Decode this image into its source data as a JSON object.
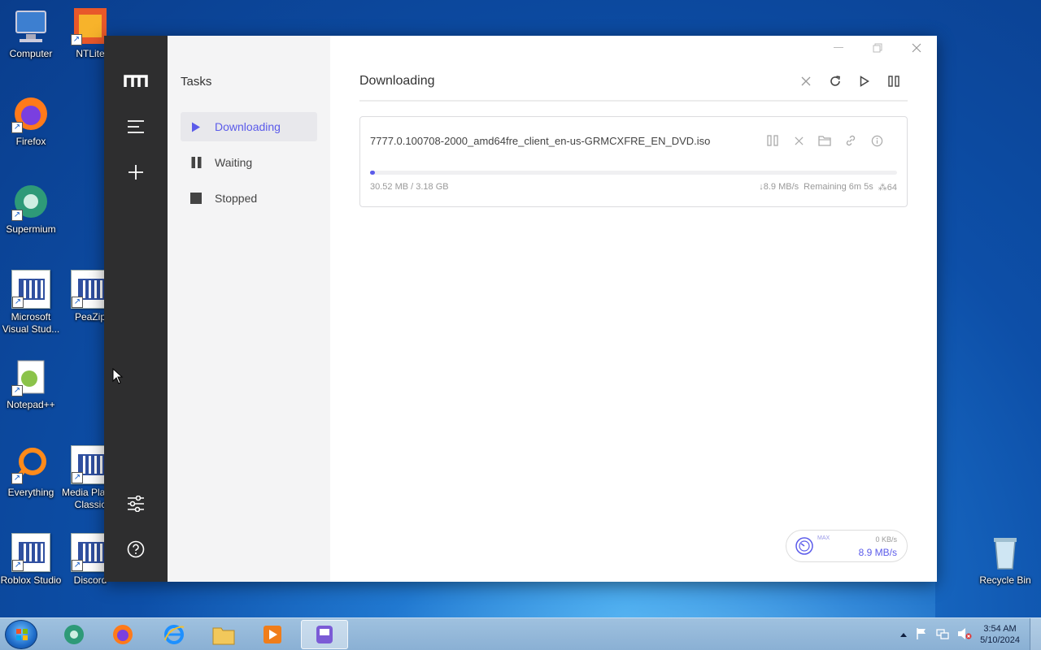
{
  "desktop": {
    "icons": [
      {
        "label": "Computer"
      },
      {
        "label": "NTLite"
      },
      {
        "label": "Firefox"
      },
      {
        "label": "Supermium"
      },
      {
        "label": "Microsoft Visual Stud..."
      },
      {
        "label": "PeaZip"
      },
      {
        "label": "Notepad++"
      },
      {
        "label": "Everything"
      },
      {
        "label": "Media Player Classic"
      },
      {
        "label": "Roblox Studio"
      },
      {
        "label": "Discord"
      },
      {
        "label": "Recycle Bin"
      }
    ]
  },
  "sidebar": {
    "title": "Tasks",
    "items": [
      {
        "label": "Downloading",
        "icon": "play-icon",
        "active": true
      },
      {
        "label": "Waiting",
        "icon": "pause-icon",
        "active": false
      },
      {
        "label": "Stopped",
        "icon": "stop-icon",
        "active": false
      }
    ]
  },
  "main": {
    "title": "Downloading",
    "task": {
      "file_name": "7777.0.100708-2000_amd64fre_client_en-us-GRMCXFRE_EN_DVD.iso",
      "size_text": "30.52 MB / 3.18 GB",
      "speed_text": "↓8.9 MB/s",
      "remaining_text": "Remaining 6m 5s",
      "connections_text": "⁂64",
      "progress_fraction": 0.0096
    },
    "speedometer": {
      "max_label": "MAX",
      "limit_text": "0 KB/s",
      "speed_text": "8.9 MB/s"
    }
  },
  "taskbar": {
    "time": "3:54 AM",
    "date": "5/10/2024"
  },
  "colors": {
    "accent": "#5b5bea",
    "rail": "#2e2e2f",
    "sidebar": "#f4f4f5"
  }
}
